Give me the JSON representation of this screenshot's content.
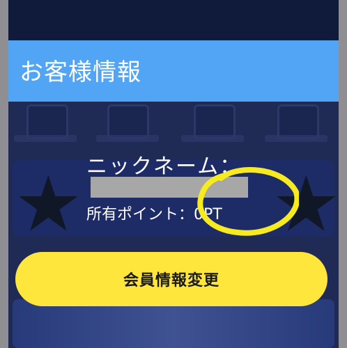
{
  "header": {
    "title": "お客様情報"
  },
  "profile": {
    "nickname_label": "ニックネーム：",
    "points_label": "所有ポイント：",
    "points_value": "0PT"
  },
  "actions": {
    "edit_member_info": "会員情報変更"
  },
  "colors": {
    "header_bg": "#52a5f5",
    "page_bg": "#1f2a55",
    "button_bg": "#ffe63d",
    "annotation": "#f7ea1f",
    "redaction": "#a7a7a7"
  }
}
